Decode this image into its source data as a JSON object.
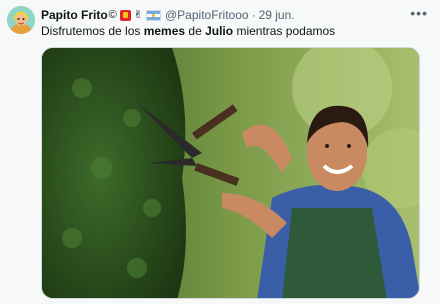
{
  "tweet": {
    "author": {
      "display_name": "Papito Frito",
      "name_symbol": "©",
      "handle": "@PapitoFritooo",
      "avatar_icon": "cartoon-character-avatar"
    },
    "separator": "·",
    "date": "29 jun.",
    "more_label": "•••",
    "text_parts": {
      "part1": "Disfrutemos de los ",
      "bold1": "memes",
      "part2": " de ",
      "bold2": "Julio",
      "part3": " mientras podamos"
    },
    "media": {
      "description_icon": "man-trimming-hedge-photo"
    }
  },
  "colors": {
    "background": "#f7f9f9",
    "text": "#0f1419",
    "muted": "#536471"
  }
}
